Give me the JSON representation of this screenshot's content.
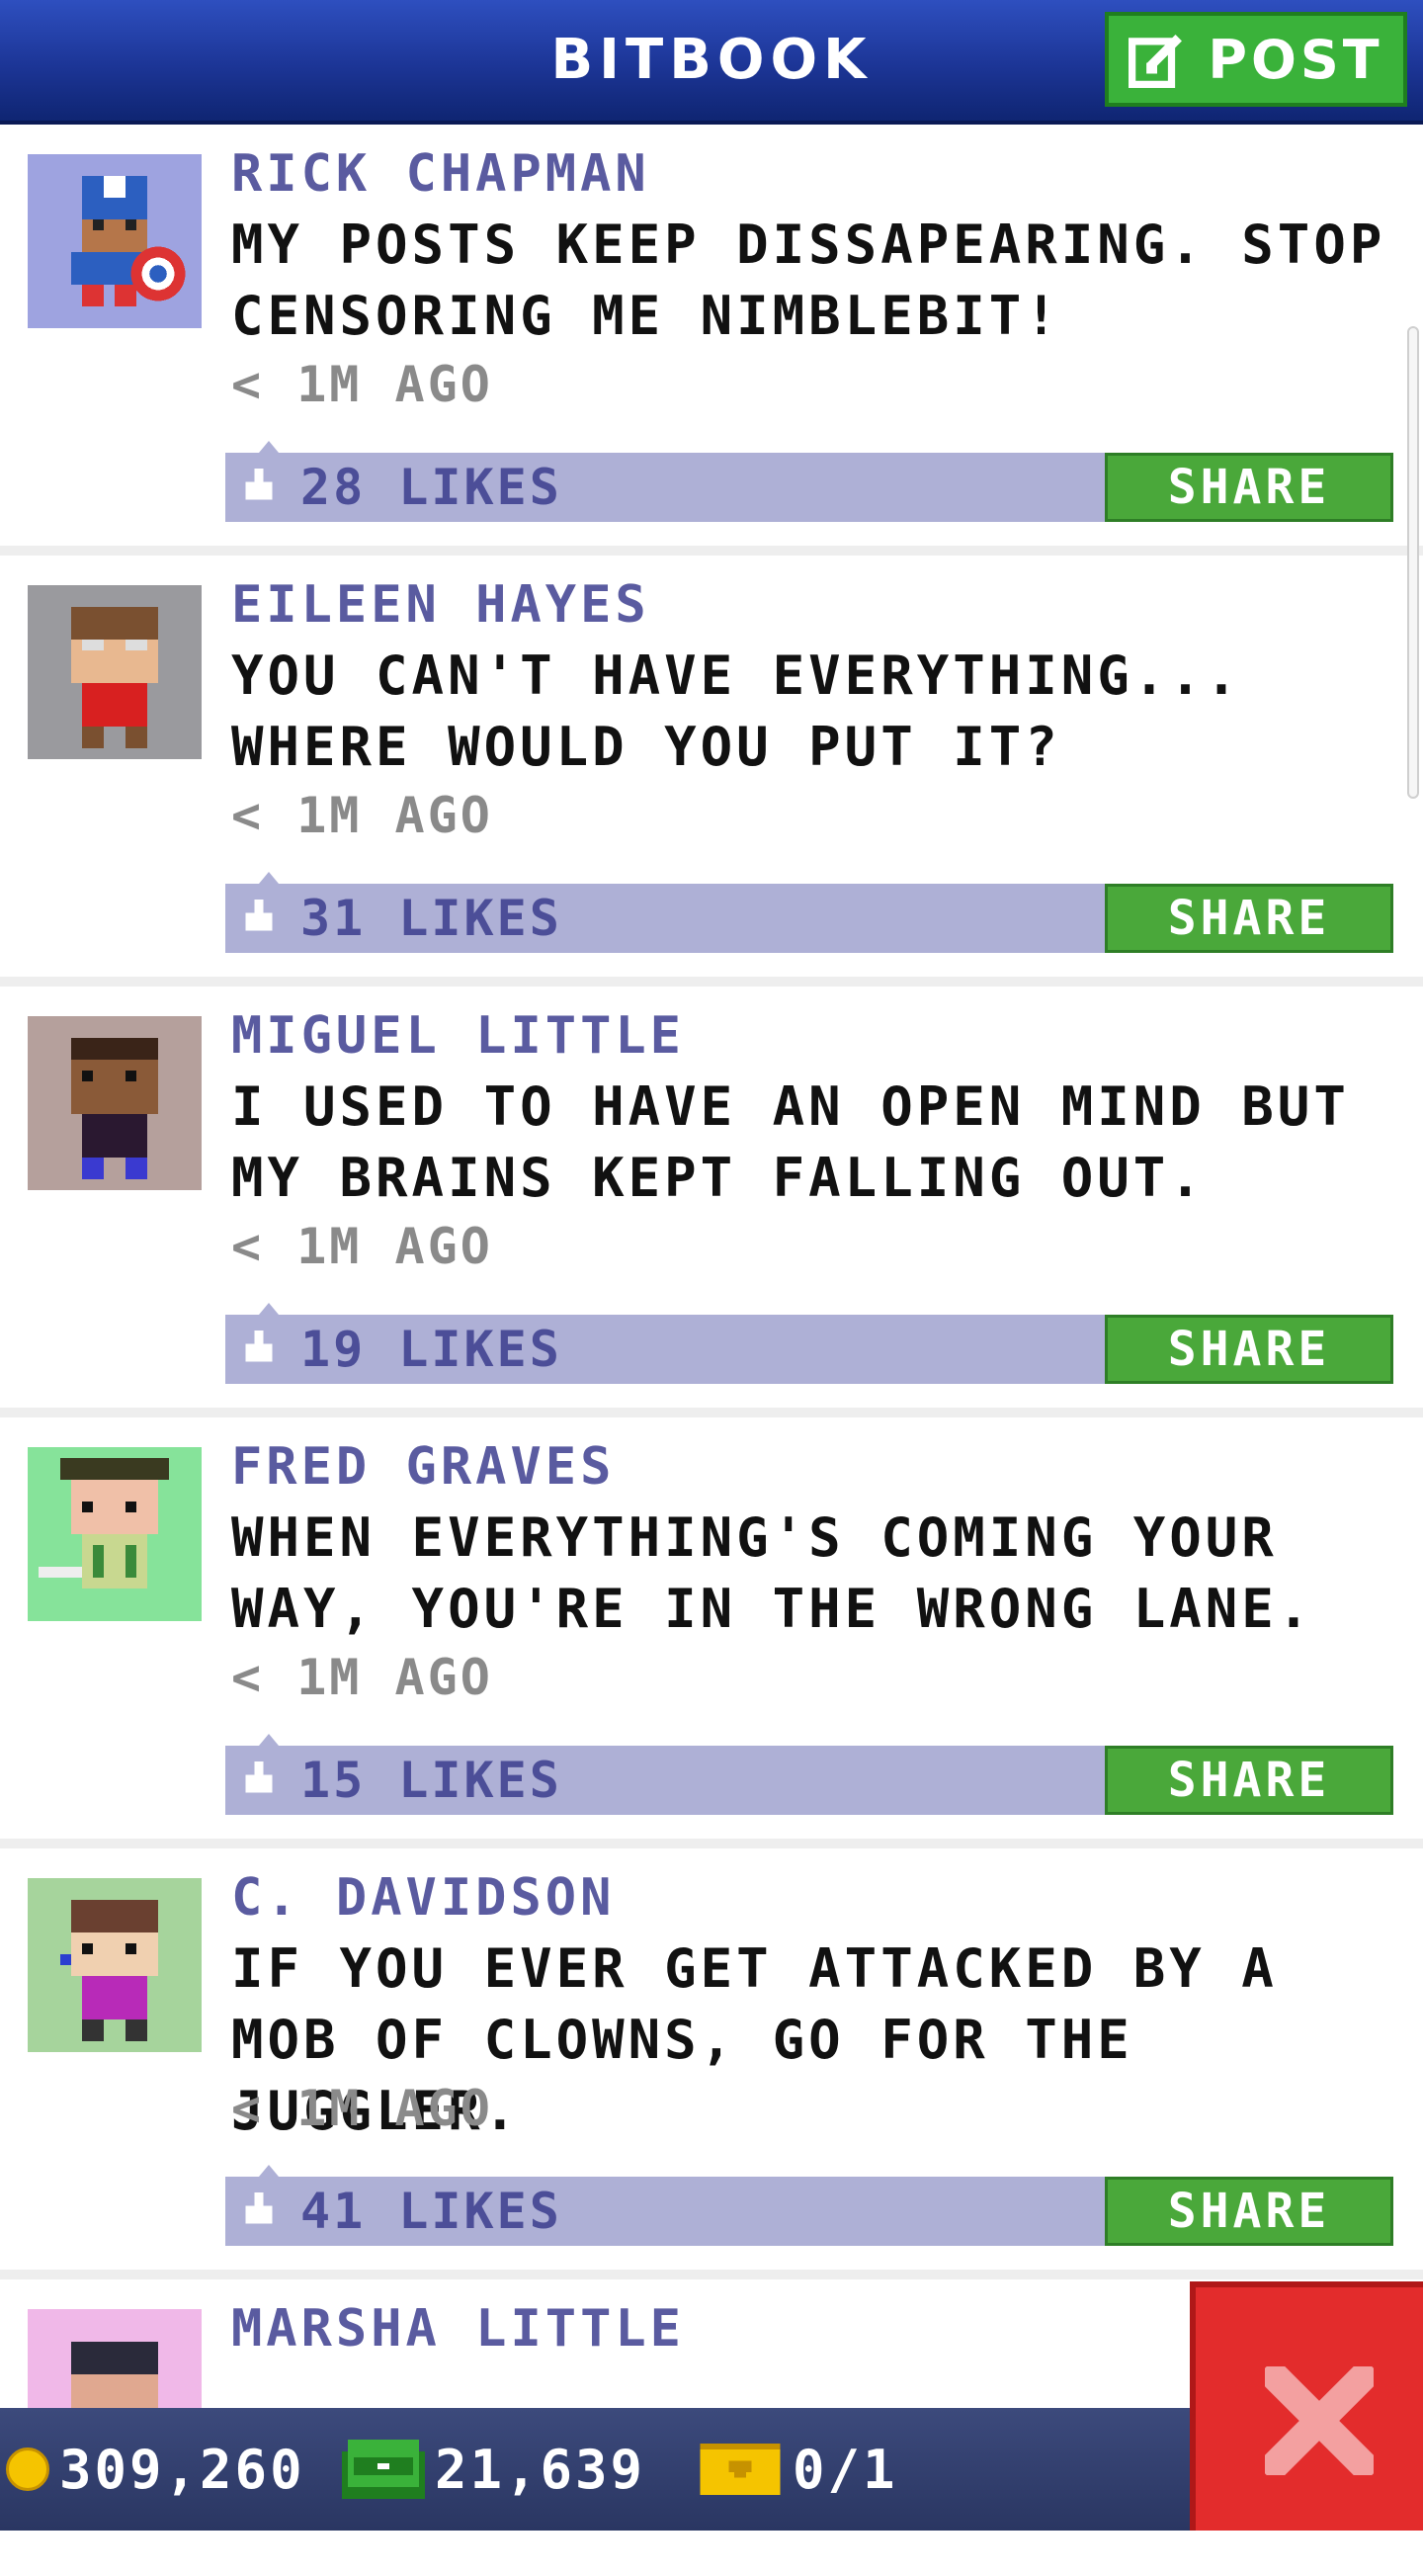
{
  "header": {
    "title": "BITBOOK",
    "post_label": "POST"
  },
  "posts": [
    {
      "author": "RICK CHAPMAN",
      "message": "MY POSTS KEEP DISSAPEARING. STOP CENSORING ME NIMBLEBIT!",
      "time": "< 1M AGO",
      "likes": "28 LIKES",
      "share": "SHARE",
      "avatar_bg": "#9ea3e0"
    },
    {
      "author": "EILEEN HAYES",
      "message": "YOU CAN'T HAVE EVERYTHING... WHERE WOULD YOU PUT IT?",
      "time": "< 1M AGO",
      "likes": "31 LIKES",
      "share": "SHARE",
      "avatar_bg": "#9a9a9e"
    },
    {
      "author": "MIGUEL LITTLE",
      "message": "I USED TO HAVE AN OPEN MIND BUT MY BRAINS KEPT FALLING OUT.",
      "time": "< 1M AGO",
      "likes": "19 LIKES",
      "share": "SHARE",
      "avatar_bg": "#b5a09c"
    },
    {
      "author": "FRED GRAVES",
      "message": "WHEN EVERYTHING'S COMING YOUR WAY, YOU'RE IN THE WRONG LANE.",
      "time": "< 1M AGO",
      "likes": "15 LIKES",
      "share": "SHARE",
      "avatar_bg": "#86e39a"
    },
    {
      "author": "C. DAVIDSON",
      "message": "IF YOU EVER GET ATTACKED BY A MOB OF CLOWNS, GO FOR THE JUGGLER.",
      "time": "< 1M AGO",
      "likes": "41 LIKES",
      "share": "SHARE",
      "avatar_bg": "#a6d49c"
    },
    {
      "author": "MARSHA LITTLE",
      "avatar_bg": "#f0b8e8"
    }
  ],
  "status": {
    "coins": "309,260",
    "bux": "21,639",
    "tickets": "0/1"
  },
  "colors": {
    "header": "#1c3596",
    "share_green": "#4aa83a",
    "likes_bar": "#aeb0d6",
    "close_red": "#e32c2c"
  },
  "icons": {
    "post": "compose-icon",
    "like": "thumbs-up-icon",
    "coin": "coin-icon",
    "bux": "bux-icon",
    "ticket": "ticket-icon",
    "close": "close-icon"
  }
}
